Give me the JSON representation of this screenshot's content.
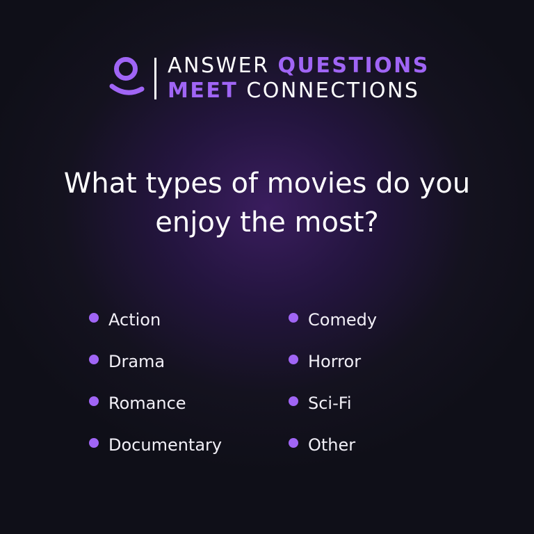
{
  "brand": {
    "line1_white": "ANSWER",
    "line1_purple": "QUESTIONS",
    "line2_purple": "MEET",
    "line2_white": "CONNECTIONS",
    "logo_icon": "user-avatar-icon",
    "accent_color": "#a065f5"
  },
  "question": {
    "line1": "What types of movies do you",
    "line2": "enjoy the most?"
  },
  "options": [
    "Action",
    "Drama",
    "Romance",
    "Documentary",
    "Comedy",
    "Horror",
    "Sci-Fi",
    "Other"
  ]
}
